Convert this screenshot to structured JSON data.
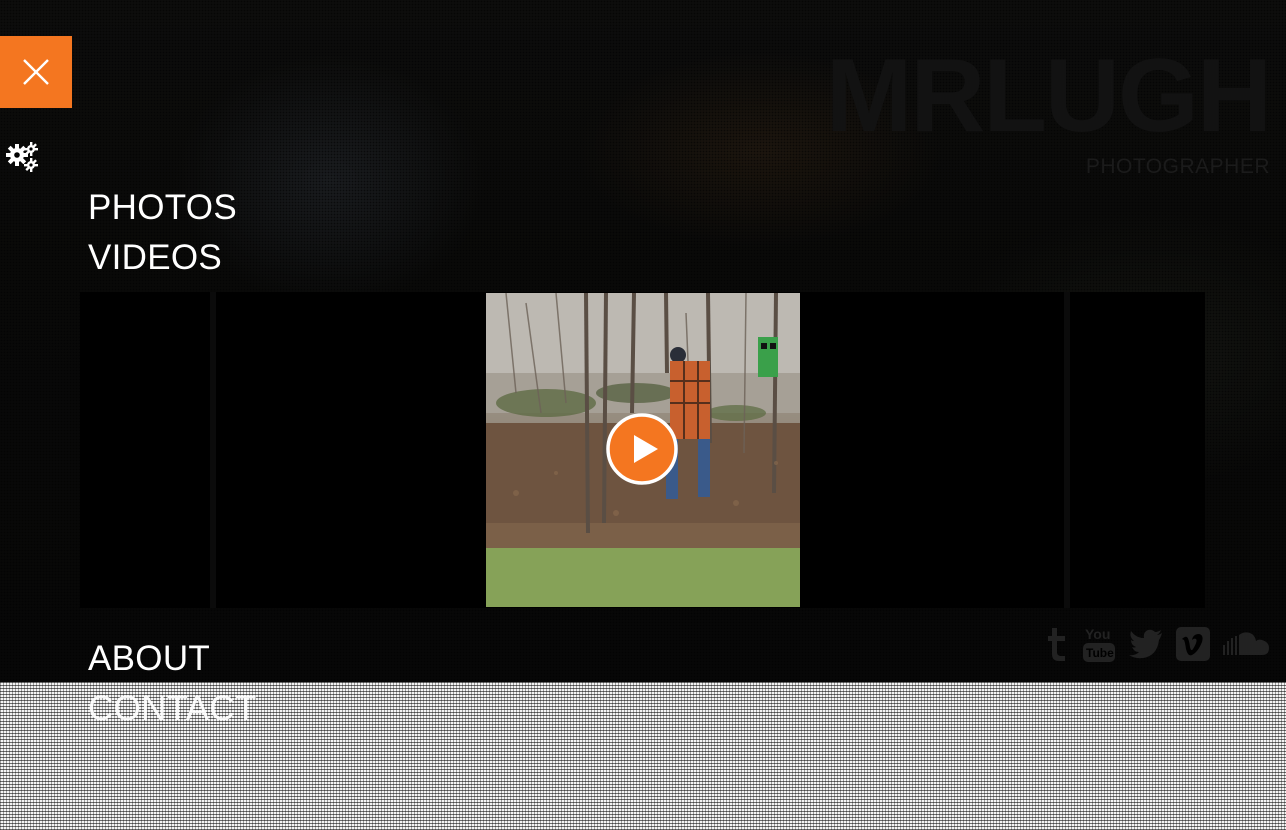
{
  "brand": {
    "title": "MRLUGH",
    "subtitle": "PHOTOGRAPHER"
  },
  "controls": {
    "close_icon": "close-icon",
    "settings_icon": "gears-icon"
  },
  "nav": {
    "items": [
      {
        "label": "PHOTOS"
      },
      {
        "label": "VIDEOS"
      },
      {
        "label": "ABOUT"
      },
      {
        "label": "CONTACT"
      }
    ]
  },
  "video": {
    "play_icon": "play-icon",
    "accent_color": "#f47620"
  },
  "social": {
    "icons": [
      "tumblr-icon",
      "youtube-icon",
      "twitter-icon",
      "vimeo-icon",
      "soundcloud-icon"
    ],
    "youtube_text_top": "You",
    "youtube_text_bottom": "Tube"
  },
  "colors": {
    "accent": "#f47620",
    "background": "#000000",
    "nav_text": "#ffffff"
  }
}
